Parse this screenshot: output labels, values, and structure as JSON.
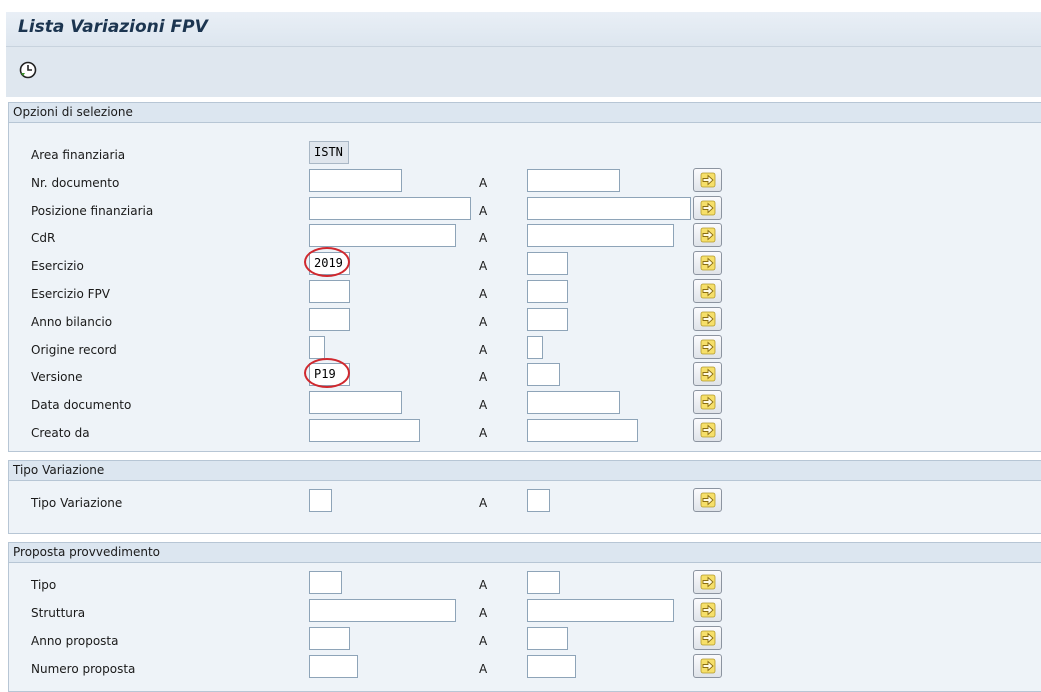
{
  "page": {
    "title": "Lista Variazioni FPV"
  },
  "toolbar": {
    "execute_icon": "execute-clock-icon"
  },
  "range_label": "A",
  "groups": [
    {
      "title": "Opzioni di selezione",
      "rows": [
        {
          "label": "Area finanziaria",
          "from": "ISTN",
          "single": true
        },
        {
          "label": "Nr. documento",
          "from": "",
          "to": ""
        },
        {
          "label": "Posizione finanziaria",
          "from": "",
          "to": ""
        },
        {
          "label": "CdR",
          "from": "",
          "to": ""
        },
        {
          "label": "Esercizio",
          "from": "2019",
          "to": "",
          "highlighted": true
        },
        {
          "label": "Esercizio FPV",
          "from": "",
          "to": ""
        },
        {
          "label": "Anno bilancio",
          "from": "",
          "to": ""
        },
        {
          "label": "Origine record",
          "from": "",
          "to": ""
        },
        {
          "label": "Versione",
          "from": "P19",
          "to": "",
          "highlighted": true
        },
        {
          "label": "Data documento",
          "from": "",
          "to": ""
        },
        {
          "label": "Creato da",
          "from": "",
          "to": ""
        }
      ]
    },
    {
      "title": "Tipo Variazione",
      "rows": [
        {
          "label": "Tipo Variazione",
          "from": "",
          "to": ""
        }
      ]
    },
    {
      "title": "Proposta provvedimento",
      "rows": [
        {
          "label": "Tipo",
          "from": "",
          "to": ""
        },
        {
          "label": "Struttura",
          "from": "",
          "to": ""
        },
        {
          "label": "Anno proposta",
          "from": "",
          "to": ""
        },
        {
          "label": "Numero proposta",
          "from": "",
          "to": ""
        }
      ]
    }
  ],
  "colors": {
    "highlight": "#d0282e",
    "header_bg": "#dce6f0",
    "group_bg": "#eef3f8"
  }
}
